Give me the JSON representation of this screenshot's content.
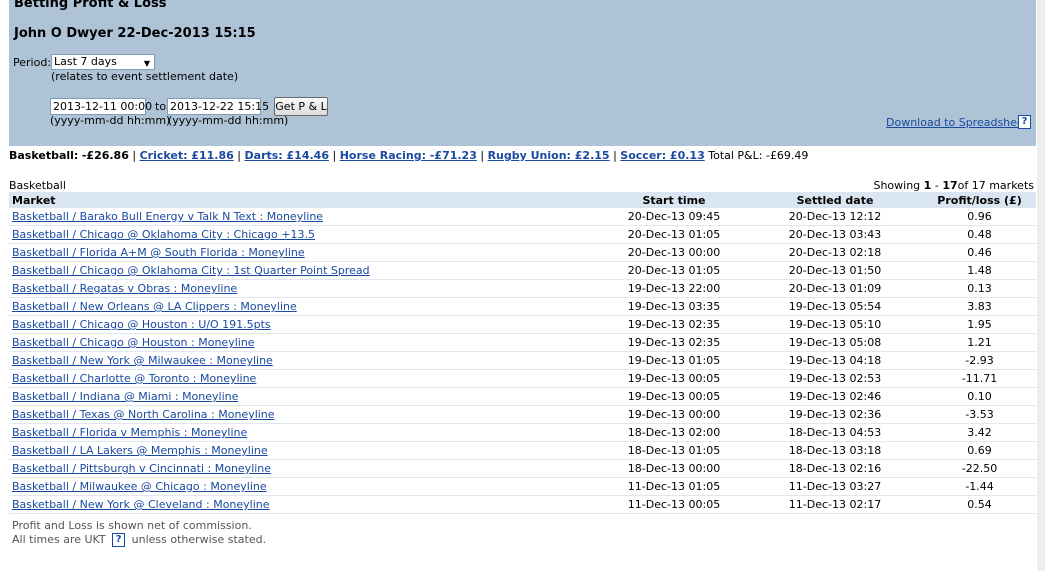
{
  "title": "Betting Profit & Loss",
  "subtitle": "John O Dwyer 22-Dec-2013 15:15",
  "period": {
    "label": "Period:",
    "selected": "Last 7 days",
    "note": "(relates to event settlement date)"
  },
  "range": {
    "from_value": "2013-12-11 00:00",
    "to_label": "to",
    "to_value": "2013-12-22 15:15",
    "button_label": "Get P & L",
    "format_from": "(yyyy-mm-dd hh:mm)",
    "format_to": "(yyyy-mm-dd hh:mm)"
  },
  "download_label": "Download to Spreadsheet",
  "help_glyph": "?",
  "summary": {
    "current": "Basketball:",
    "current_value": "-£26.86",
    "links": [
      "Cricket: £11.86",
      "Darts: £14.46",
      "Horse Racing: -£71.23",
      "Rugby Union: £2.15",
      "Soccer: £0.13"
    ],
    "separator": "|",
    "total_label": "Total P&L:",
    "total_value": "-£69.49"
  },
  "section_label": "Basketball",
  "showing": {
    "prefix": "Showing",
    "range_start": "1",
    "dash": "-",
    "range_end": "17",
    "of_text": "of 17 markets"
  },
  "table": {
    "headers": [
      "Market",
      "Start time",
      "Settled date",
      "Profit/loss (£)"
    ],
    "rows": [
      [
        "Basketball / Barako Bull Energy v Talk N Text : Moneyline",
        "20-Dec-13 09:45",
        "20-Dec-13 12:12",
        "0.96"
      ],
      [
        "Basketball / Chicago @ Oklahoma City : Chicago +13.5",
        "20-Dec-13 01:05",
        "20-Dec-13 03:43",
        "0.48"
      ],
      [
        "Basketball / Florida A+M @ South Florida : Moneyline",
        "20-Dec-13 00:00",
        "20-Dec-13 02:18",
        "0.46"
      ],
      [
        "Basketball / Chicago @ Oklahoma City : 1st Quarter Point Spread",
        "20-Dec-13 01:05",
        "20-Dec-13 01:50",
        "1.48"
      ],
      [
        "Basketball / Regatas v Obras : Moneyline",
        "19-Dec-13 22:00",
        "20-Dec-13 01:09",
        "0.13"
      ],
      [
        "Basketball / New Orleans @ LA Clippers : Moneyline",
        "19-Dec-13 03:35",
        "19-Dec-13 05:54",
        "3.83"
      ],
      [
        "Basketball / Chicago @ Houston : U/O 191.5pts",
        "19-Dec-13 02:35",
        "19-Dec-13 05:10",
        "1.95"
      ],
      [
        "Basketball / Chicago @ Houston : Moneyline",
        "19-Dec-13 02:35",
        "19-Dec-13 05:08",
        "1.21"
      ],
      [
        "Basketball / New York @ Milwaukee : Moneyline",
        "19-Dec-13 01:05",
        "19-Dec-13 04:18",
        "-2.93"
      ],
      [
        "Basketball / Charlotte @ Toronto : Moneyline",
        "19-Dec-13 00:05",
        "19-Dec-13 02:53",
        "-11.71"
      ],
      [
        "Basketball / Indiana @ Miami : Moneyline",
        "19-Dec-13 00:05",
        "19-Dec-13 02:46",
        "0.10"
      ],
      [
        "Basketball / Texas @ North Carolina : Moneyline",
        "19-Dec-13 00:00",
        "19-Dec-13 02:36",
        "-3.53"
      ],
      [
        "Basketball / Florida v Memphis : Moneyline",
        "18-Dec-13 02:00",
        "18-Dec-13 04:53",
        "3.42"
      ],
      [
        "Basketball / LA Lakers @ Memphis : Moneyline",
        "18-Dec-13 01:05",
        "18-Dec-13 03:18",
        "0.69"
      ],
      [
        "Basketball / Pittsburgh v Cincinnati : Moneyline",
        "18-Dec-13 00:00",
        "18-Dec-13 02:16",
        "-22.50"
      ],
      [
        "Basketball / Milwaukee @ Chicago : Moneyline",
        "11-Dec-13 01:05",
        "11-Dec-13 03:27",
        "-1.44"
      ],
      [
        "Basketball / New York @ Cleveland : Moneyline",
        "11-Dec-13 00:05",
        "11-Dec-13 02:17",
        "0.54"
      ]
    ]
  },
  "footer": {
    "line1": "Profit and Loss is shown net of commission.",
    "line2_prefix": "All times are UKT",
    "line2_suffix": "unless otherwise stated."
  },
  "colors": {
    "panel_bg": "#aec4d6",
    "header_bg": "#d9e6f1",
    "link": "#1a4aa0"
  }
}
